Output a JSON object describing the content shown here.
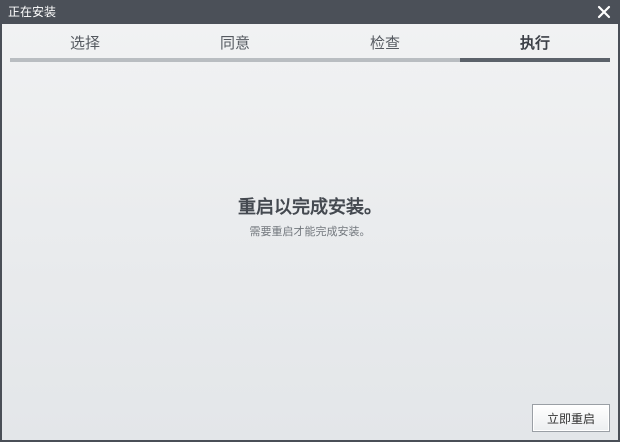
{
  "window": {
    "title": "正在安装",
    "close_icon": "close-icon"
  },
  "steps": [
    {
      "label": "选择",
      "active": false
    },
    {
      "label": "同意",
      "active": false
    },
    {
      "label": "检查",
      "active": false
    },
    {
      "label": "执行",
      "active": true
    }
  ],
  "message": {
    "title": "重启以完成安装。",
    "subtitle": "需要重启才能完成安装。"
  },
  "actions": {
    "restart_label": "立即重启"
  },
  "colors": {
    "titlebar": "#4b5058",
    "step_bar": "#b9bdc1",
    "step_bar_active": "#5c626a"
  }
}
